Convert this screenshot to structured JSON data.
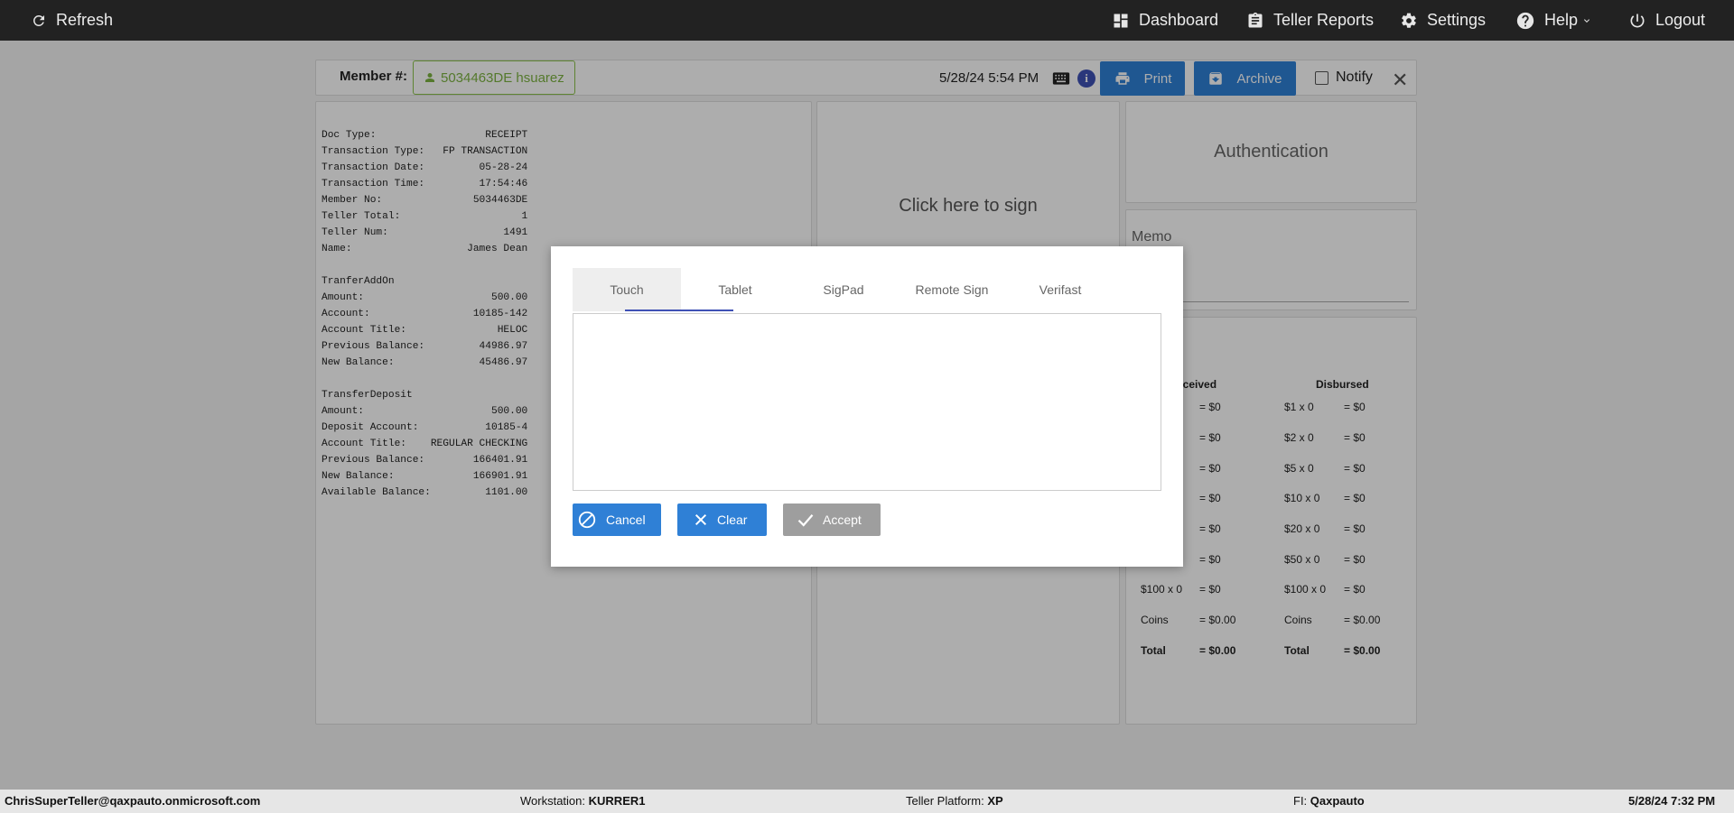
{
  "nav": {
    "refresh": "Refresh",
    "dashboard": "Dashboard",
    "teller_reports": "Teller Reports",
    "settings": "Settings",
    "help": "Help",
    "logout": "Logout"
  },
  "header": {
    "member_label": "Member #:",
    "member_value": "5034463DE hsuarez",
    "datetime": "5/28/24 5:54 PM",
    "print": "Print",
    "archive": "Archive",
    "notify": "Notify"
  },
  "receipt": "Doc Type:                  RECEIPT\nTransaction Type:   FP TRANSACTION\nTransaction Date:         05-28-24\nTransaction Time:         17:54:46\nMember No:               5034463DE\nTeller Total:                    1\nTeller Num:                   1491\nName:                   James Dean\n\nTranferAddOn\nAmount:                     500.00\nAccount:                 10185-142\nAccount Title:               HELOC\nPrevious Balance:         44986.97\nNew Balance:              45486.97\n\nTransferDeposit\nAmount:                     500.00\nDeposit Account:           10185-4\nAccount Title:    REGULAR CHECKING\nPrevious Balance:        166401.91\nNew Balance:             166901.91\nAvailable Balance:         1101.00",
  "sign": {
    "click_to_sign": "Click here to sign"
  },
  "auth": {
    "title": "Authentication"
  },
  "memo": {
    "label": "Memo"
  },
  "cash": {
    "received_header": "eceived",
    "disbursed_header": "Disbursed",
    "received": [
      {
        "label": "",
        "value": "= $0"
      },
      {
        "label": "",
        "value": "= $0"
      },
      {
        "label": "",
        "value": "= $0"
      },
      {
        "label": "",
        "value": "= $0"
      },
      {
        "label": "",
        "value": "= $0"
      },
      {
        "label": "",
        "value": "= $0"
      },
      {
        "label": "$100 x 0",
        "value": "= $0"
      },
      {
        "label": "Coins",
        "value": "= $0.00"
      },
      {
        "label": "Total",
        "value": "= $0.00"
      }
    ],
    "disbursed": [
      {
        "label": "$1 x 0",
        "value": "= $0"
      },
      {
        "label": "$2 x 0",
        "value": "= $0"
      },
      {
        "label": "$5 x 0",
        "value": "= $0"
      },
      {
        "label": "$10 x 0",
        "value": "= $0"
      },
      {
        "label": "$20 x 0",
        "value": "= $0"
      },
      {
        "label": "$50 x 0",
        "value": "= $0"
      },
      {
        "label": "$100 x 0",
        "value": "= $0"
      },
      {
        "label": "Coins",
        "value": "= $0.00"
      },
      {
        "label": "Total",
        "value": "= $0.00"
      }
    ]
  },
  "modal": {
    "tabs": [
      "Touch",
      "Tablet",
      "SigPad",
      "Remote Sign",
      "Verifast"
    ],
    "cancel": "Cancel",
    "clear": "Clear",
    "accept": "Accept"
  },
  "footer": {
    "user": "ChrisSuperTeller@qaxpauto.onmicrosoft.com",
    "workstation_label": "Workstation:",
    "workstation": "KURRER1",
    "platform_label": "Teller Platform:",
    "platform": "XP",
    "fi_label": "FI:",
    "fi": "Qaxpauto",
    "datetime": "5/28/24 7:32 PM"
  }
}
